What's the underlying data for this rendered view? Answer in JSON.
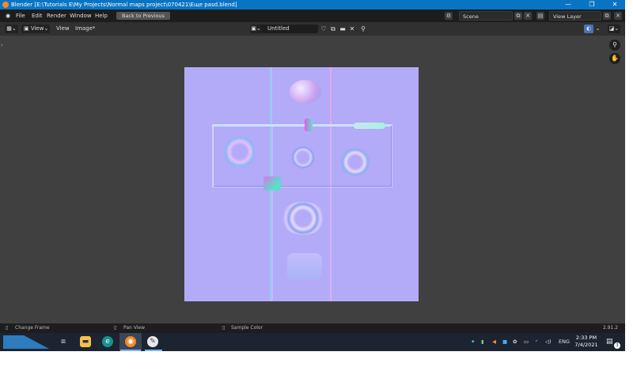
{
  "title_bar": {
    "title": "Blender [E:\\Tutorials E\\My Projects\\Normal maps project\\070421\\Еще pasd.blend]",
    "minimize": "—",
    "maximize": "❐",
    "close": "✕"
  },
  "menu": {
    "items": [
      "File",
      "Edit",
      "Render",
      "Window",
      "Help"
    ],
    "back_to_previous": "Back to Previous",
    "scene": "Scene",
    "view_layer": "View Layer"
  },
  "editor_header": {
    "view_dropdown": "View",
    "menus": [
      "View",
      "Image*"
    ],
    "image_name": "Untitled"
  },
  "status_bar": {
    "change_frame": "Change Frame",
    "pan_view": "Pan View",
    "sample_color": "Sample Color",
    "version": "2.91.2"
  },
  "taskbar": {
    "language": "ENG",
    "time": "2:33 PM",
    "date": "7/4/2021",
    "notifications": "3"
  },
  "colors": {
    "accent": "#0a74c4",
    "normal_map_base": "#b3aaf8",
    "viewport_bg": "#404040"
  }
}
